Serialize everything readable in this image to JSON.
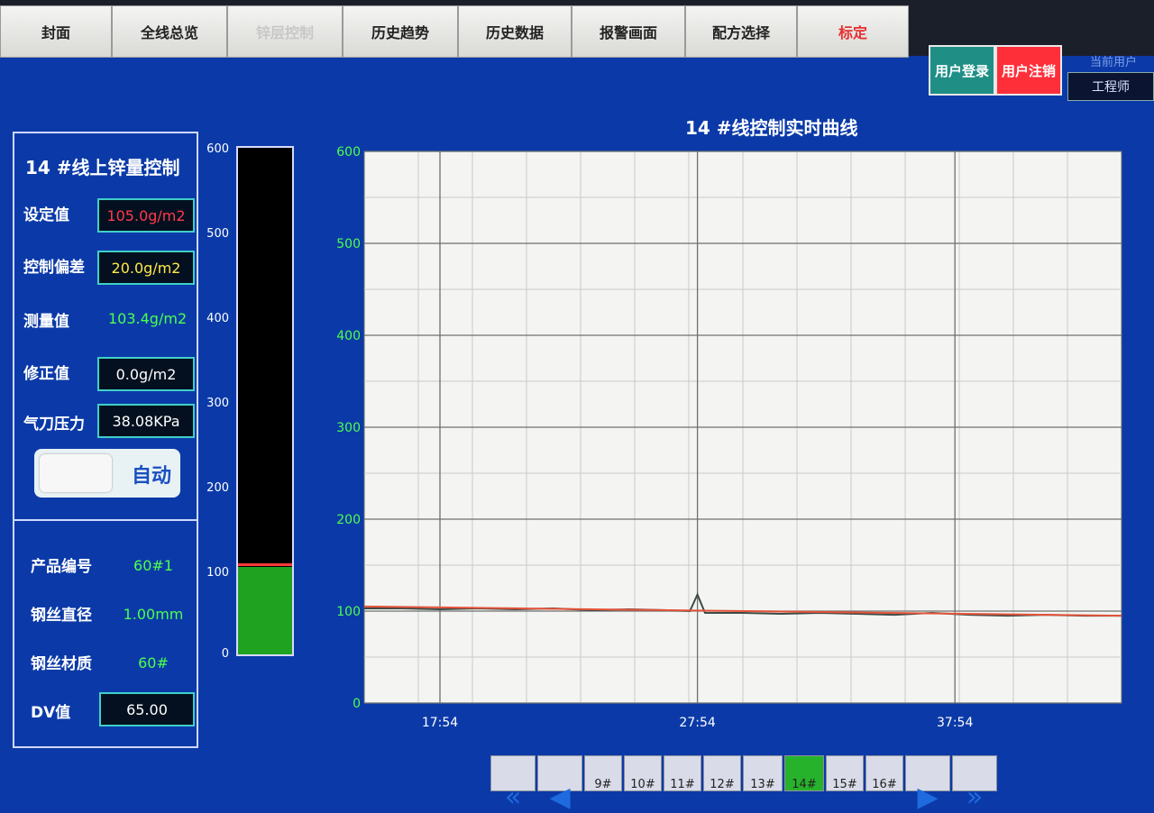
{
  "nav": {
    "tabs": [
      {
        "label": "封面",
        "state": "normal"
      },
      {
        "label": "全线总览",
        "state": "normal"
      },
      {
        "label": "锌层控制",
        "state": "disabled"
      },
      {
        "label": "历史趋势",
        "state": "normal"
      },
      {
        "label": "历史数据",
        "state": "normal"
      },
      {
        "label": "报警画面",
        "state": "normal"
      },
      {
        "label": "配方选择",
        "state": "normal"
      },
      {
        "label": "标定",
        "state": "alert"
      }
    ],
    "login_label": "用户登录",
    "logout_label": "用户注销",
    "current_user_label": "当前用户",
    "current_user_value": "工程师"
  },
  "control_panel": {
    "title": "14 #线上锌量控制",
    "setpoint_label": "设定值",
    "setpoint_value": "105.0g/m2",
    "deviation_label": "控制偏差",
    "deviation_value": "20.0g/m2",
    "measured_label": "测量值",
    "measured_value": "103.4g/m2",
    "correction_label": "修正值",
    "correction_value": "0.0g/m2",
    "pressure_label": "气刀压力",
    "pressure_value": "38.08KPa",
    "mode_label": "自动"
  },
  "product_info": {
    "product_no_label": "产品编号",
    "product_no_value": "60#1",
    "wire_diameter_label": "钢丝直径",
    "wire_diameter_value": "1.00mm",
    "wire_material_label": "钢丝材质",
    "wire_material_value": "60#",
    "dv_label": "DV值",
    "dv_value": "65.00"
  },
  "gauge": {
    "ticks": [
      "600",
      "500",
      "400",
      "300",
      "200",
      "100",
      "0"
    ],
    "max": 600,
    "value": 103.4,
    "setpoint": 105
  },
  "chart_data": {
    "type": "line",
    "title": "14 #线控制实时曲线",
    "xlabel": "",
    "ylabel": "",
    "ylim": [
      0,
      600
    ],
    "yticks": [
      "0",
      "100",
      "200",
      "300",
      "400",
      "500",
      "600"
    ],
    "xtick_labels": [
      "17:54",
      "27:54",
      "37:54"
    ],
    "xtick_positions": [
      0.1,
      0.44,
      0.78
    ],
    "grid": true,
    "series": [
      {
        "color": "#3d4b46",
        "x": [
          0,
          0.05,
          0.1,
          0.15,
          0.2,
          0.25,
          0.3,
          0.35,
          0.4,
          0.43,
          0.44,
          0.45,
          0.5,
          0.55,
          0.6,
          0.65,
          0.7,
          0.75,
          0.8,
          0.85,
          0.9,
          0.95,
          1.0
        ],
        "values": [
          103,
          103,
          102,
          103,
          102,
          103,
          101,
          102,
          101,
          100,
          118,
          98,
          98,
          97,
          98,
          97,
          96,
          98,
          96,
          95,
          96,
          95,
          95
        ]
      },
      {
        "color": "#e5533a",
        "x": [
          0,
          1.0
        ],
        "values": [
          105,
          95
        ]
      }
    ]
  },
  "pager": {
    "labels": [
      "9#",
      "10#",
      "11#",
      "12#",
      "13#",
      "14#",
      "15#",
      "16#"
    ],
    "active_index": 5
  }
}
